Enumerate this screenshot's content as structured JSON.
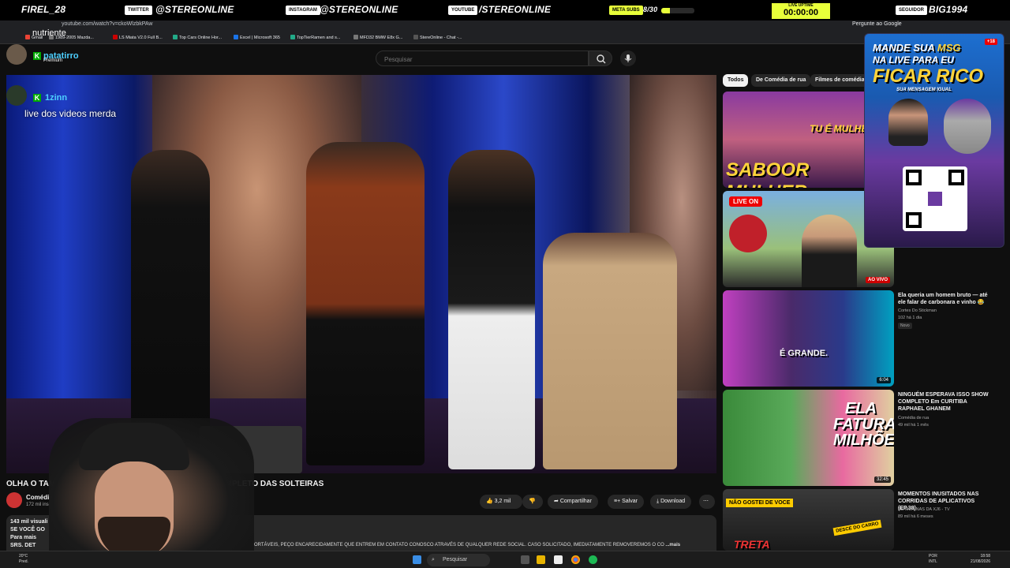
{
  "stream_bar": {
    "user_left": "FIREL_28",
    "twitter_label": "TWITTER",
    "twitter_handle": "@STEREONLINE",
    "instagram_label": "INSTAGRAM",
    "instagram_handle": "@STEREONLINE",
    "youtube_label": "YOUTUBE",
    "youtube_handle": "/STEREONLINE",
    "meta_label": "META SUBS",
    "meta_value": "8/30",
    "meta_progress": 0.27,
    "uptime_label": "LIVE UPTIME",
    "uptime_value": "00:00:00",
    "follower_label": "SEGUIDOR",
    "follower_name": "BIG1994"
  },
  "browser": {
    "url": "youtube.com/watch?v=ckoWlzbkPAw",
    "google_prompt": "Pergunte ao Google",
    "bookmarks": [
      "Gmail",
      "1989-2005 Mazda...",
      "LS Miata V2.0 Full B...",
      "Top Cars Online Hor...",
      "Excel | Microsoft 365",
      "TopTierRamen and s...",
      "MFD32 BMW E8x G...",
      "StereOnline - Chat -..."
    ]
  },
  "chat": {
    "top_message": "nutriente",
    "user1": "patatirro",
    "user1_sub": "Premium",
    "user2": "1zinn",
    "user2_message": "live dos videos merda"
  },
  "search": {
    "placeholder": "Pesquisar"
  },
  "video": {
    "title": "OLHA O TAMA",
    "title_rest": "W COMPLETO DAS SOLTEIRAS",
    "channel": "Comédia d",
    "subscribers": "172 mil inscrit",
    "actions": {
      "likes": "3,2 mil",
      "share": "Compartilhar",
      "save": "Salvar",
      "download": "Download"
    },
    "views": "143 mil visuali",
    "desc_line1": "SE VOCÊ GO",
    "desc_line2": "Para mais",
    "desc_line3": "SRS. DET",
    "desc_bottom": "ORTÁVEIS, PEÇO ENCARECIDAMENTE QUE ENTREM EM CONTATO CONOSCO ATRAVÉS DE QUALQUER REDE SOCIAL. CASO SOLICITADO, IMEDIATAMENTE REMOVEREMOS O CO",
    "more": "...mais"
  },
  "chips": [
    "Todos",
    "De Comédia de rua",
    "Filmes de comédia"
  ],
  "related": [
    {
      "thumb_text": "SABOOR MULHER",
      "thumb_text2": "TU É MULHER?"
    },
    {
      "thumb_text": "LIVE ON",
      "badge": "AO VIVO"
    },
    {
      "thumb_text": "É GRANDE.",
      "duration": "6:04",
      "title": "Ela queria um homem bruto — até ele falar de carbonara e vinho 😂",
      "channel": "Cortes Do Stickman",
      "meta": "102  há 1 dia",
      "badge": "Novo"
    },
    {
      "thumb_text": "ELA FATURA MILHÕES",
      "duration": "32:45",
      "title": "NINGUÉM ESPERAVA ISSO SHOW COMPLETO Em CURITIBA   RAPHAEL GHANEM",
      "channel": "Comédia de rua",
      "meta": "49 mil  há 1 mês"
    },
    {
      "thumb_text": "NÃO GOSTEI DE VOCE",
      "thumb_text2": "TRETA",
      "thumb_text3": "DESCE DO CARRO",
      "title": "MOMENTOS INUSITADOS NAS CORRIDAS DE APLICATIVOS (EP.38)",
      "channel": "AS MENINAS DA XJ6 - TV",
      "meta": "89 mil  há 6 meses"
    }
  ],
  "ad": {
    "line1": "MANDE SUA",
    "line1b": "MSG",
    "line2": "NA LIVE PARA EU",
    "line3": "FICAR RICO",
    "line4": "SUA MENSAGEM IGUAL",
    "tag": "+18"
  },
  "taskbar": {
    "weather": "20°C",
    "weather_desc": "Pred.",
    "search": "Pesquisar",
    "lang1": "POR",
    "lang2": "INTL",
    "time": "18:58",
    "date": "21/08/2026"
  }
}
